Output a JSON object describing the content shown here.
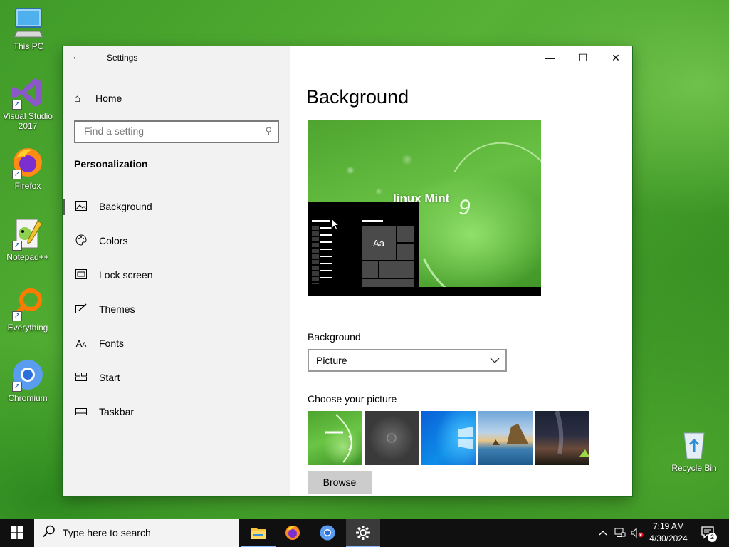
{
  "desktop": {
    "icons": [
      {
        "label": "This PC",
        "icon": "monitor-icon"
      },
      {
        "label": "Visual Studio 2017",
        "icon": "visual-studio-icon"
      },
      {
        "label": "Firefox",
        "icon": "firefox-icon"
      },
      {
        "label": "Notepad++",
        "icon": "notepad-plus-plus-icon"
      },
      {
        "label": "Everything",
        "icon": "everything-search-icon"
      },
      {
        "label": "Chromium",
        "icon": "chromium-icon"
      },
      {
        "label": "Recycle Bin",
        "icon": "recycle-bin-icon"
      }
    ]
  },
  "window": {
    "title": "Settings",
    "controls": {
      "minimize": "—",
      "maximize": "☐",
      "close": "✕"
    }
  },
  "sidebar": {
    "home_label": "Home",
    "search_placeholder": "Find a setting",
    "section_title": "Personalization",
    "items": [
      {
        "label": "Background",
        "icon": "picture-icon",
        "selected": true
      },
      {
        "label": "Colors",
        "icon": "palette-icon"
      },
      {
        "label": "Lock screen",
        "icon": "lock-screen-icon"
      },
      {
        "label": "Themes",
        "icon": "themes-brush-icon"
      },
      {
        "label": "Fonts",
        "icon": "fonts-icon"
      },
      {
        "label": "Start",
        "icon": "start-tiles-icon"
      },
      {
        "label": "Taskbar",
        "icon": "taskbar-icon"
      }
    ]
  },
  "main": {
    "title": "Background",
    "preview": {
      "logo_text": "linux Mint",
      "logo_number": "9",
      "tile_text": "Aa"
    },
    "background_label": "Background",
    "background_value": "Picture",
    "choose_label": "Choose your picture",
    "browse_label": "Browse"
  },
  "taskbar": {
    "search_placeholder": "Type here to search",
    "apps": [
      "file-explorer-icon",
      "firefox-icon",
      "chromium-icon",
      "settings-gear-icon"
    ],
    "clock_time": "7:19 AM",
    "clock_date": "4/30/2024",
    "notification_count": "2"
  },
  "colors": {
    "desktop_green": "#4aa42c",
    "sidebar_bg": "#f2f2f2",
    "taskbar_bg": "#101010",
    "accent_blue": "#0078d7"
  }
}
